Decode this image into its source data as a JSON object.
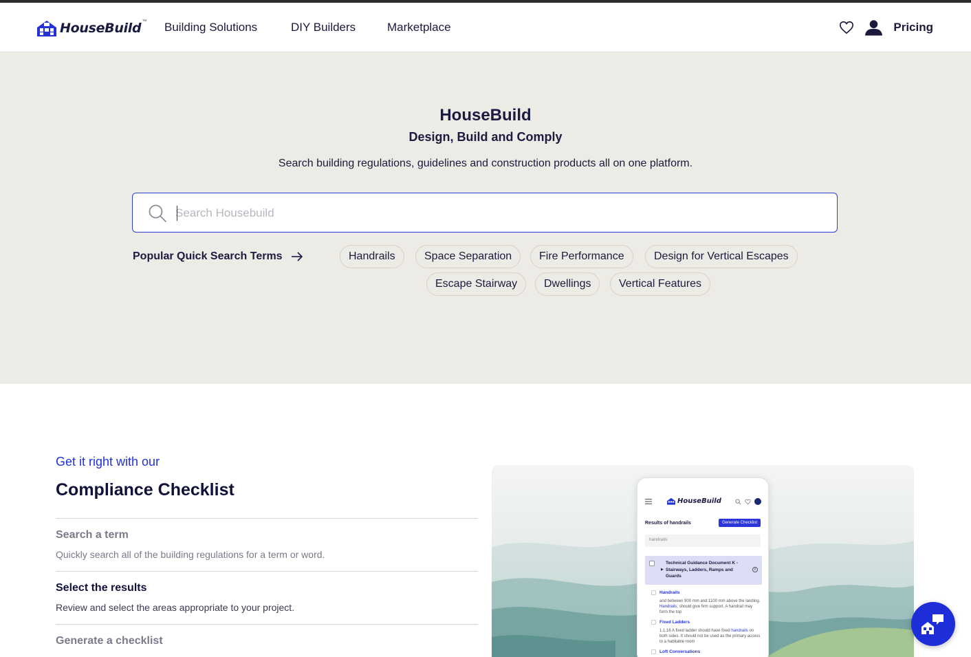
{
  "header": {
    "logo_text": "HouseBuild",
    "logo_tm": "™",
    "nav": [
      "Building Solutions",
      "DIY Builders",
      "Marketplace"
    ],
    "pricing_label": "Pricing",
    "icons": [
      "heart-icon",
      "user-icon"
    ]
  },
  "hero": {
    "title": "HouseBuild",
    "subtitle": "Design, Build and Comply",
    "description": "Search building regulations, guidelines and construction products all on one platform.",
    "search_placeholder": "Search Housebuild",
    "quick_label": "Popular Quick Search Terms",
    "chips": [
      "Handrails",
      "Space Separation",
      "Fire Performance",
      "Design for Vertical Escapes",
      "Escape Stairway",
      "Dwellings",
      "Vertical Features"
    ]
  },
  "checklist": {
    "kicker": "Get it right with our",
    "title": "Compliance Checklist",
    "steps": [
      {
        "title": "Search a term",
        "desc": "Quickly search all of the building regulations for a term or word."
      },
      {
        "title": "Select the results",
        "desc": "Review and select the areas appropriate to your project."
      },
      {
        "title": "Generate a checklist",
        "desc": ""
      }
    ]
  },
  "preview": {
    "logo_text": "HouseBuild",
    "results_label": "Results of handrails",
    "generate_label": "Generate Checklist",
    "search_value": "handrails",
    "doc_title": "Technical Guidance Document K - Stairways, Ladders, Ramps and Guards",
    "items": [
      {
        "title": "Handrails",
        "body_1": "and between 900 mm and 1100 mm above the landing.",
        "body_hl": "Handrails",
        "body_2": "should give firm support. A handrail may form the top"
      },
      {
        "title": "Fixed Ladders",
        "body_1": "1.1.16 A fixed ladder should have fixed",
        "body_hl": "handrails",
        "body_2": "on both sides. It should not be used as the primary access to a habitable room"
      },
      {
        "title": "Loft Conversations",
        "body_1": "",
        "body_hl": "",
        "body_2": ""
      }
    ]
  },
  "colors": {
    "accent": "#2232d4",
    "hero_bg": "#edebe5",
    "text_dark": "#14123a",
    "fab": "#1d2ed9"
  }
}
